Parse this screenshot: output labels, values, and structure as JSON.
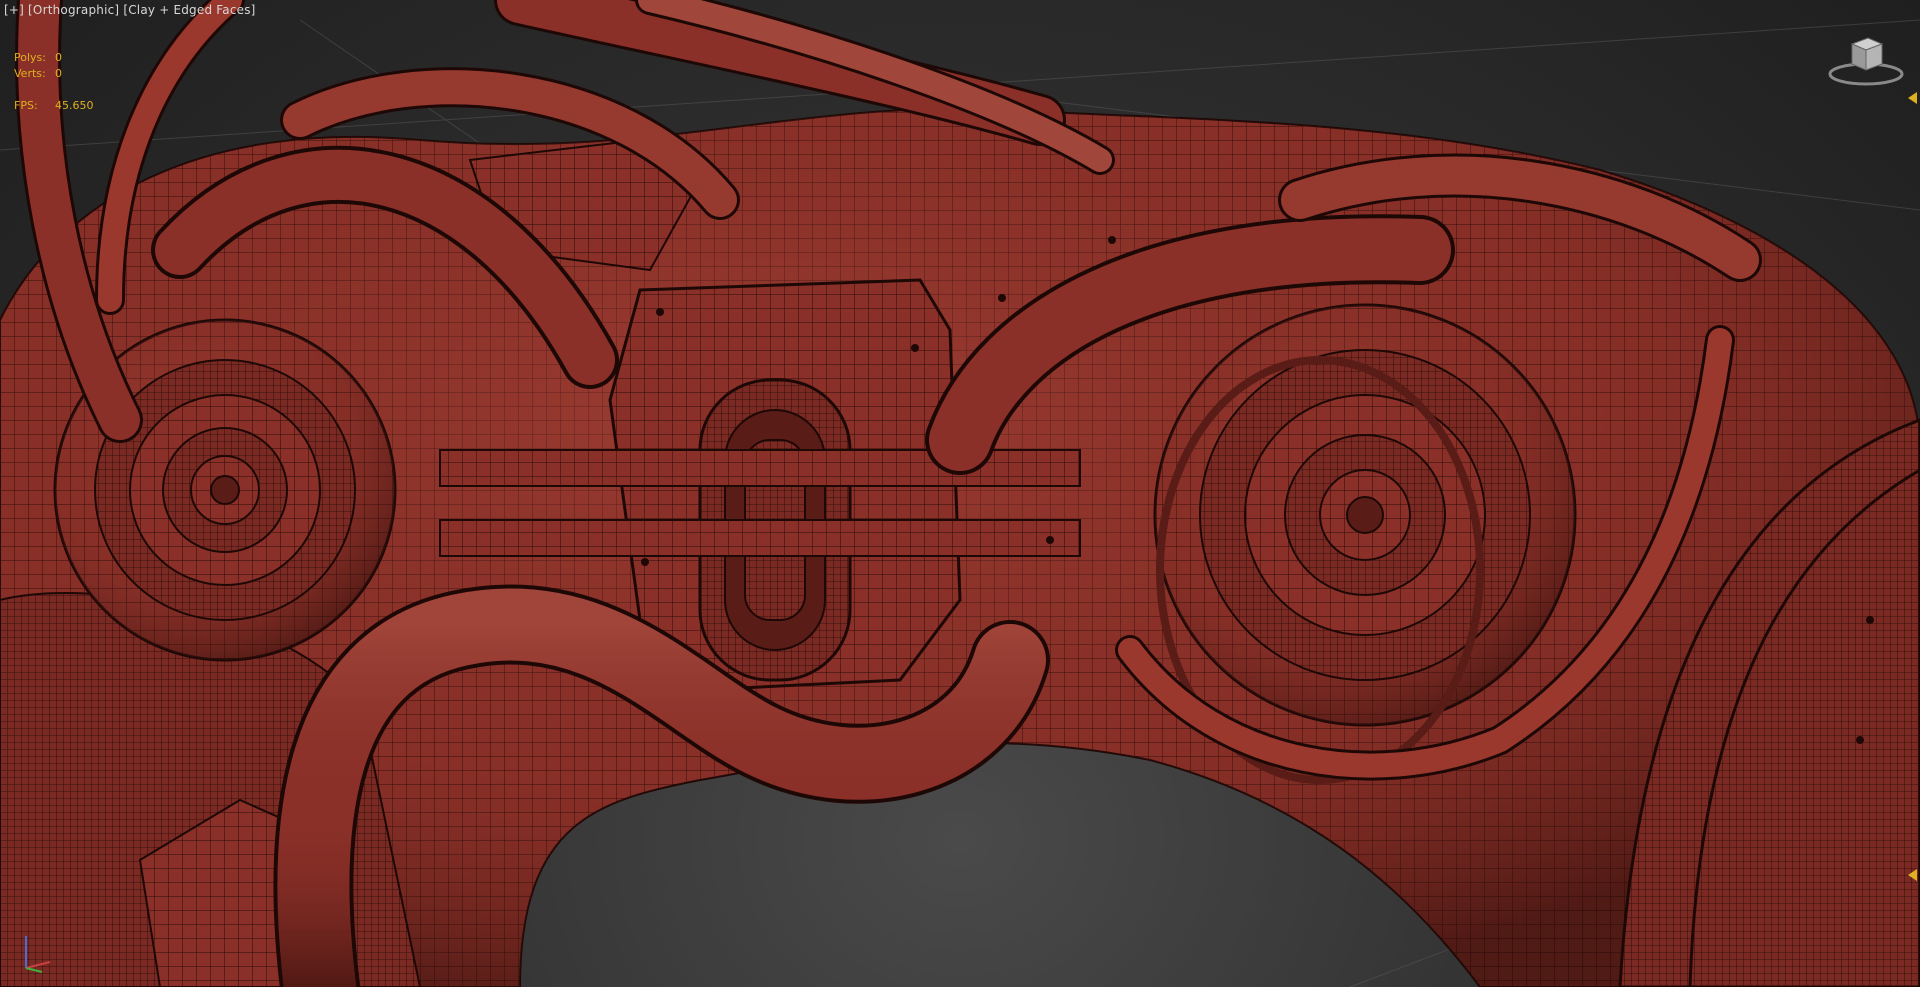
{
  "viewport": {
    "label_plus": "[+]",
    "label_view": "[Orthographic]",
    "label_shading": "[Clay + Edged Faces]"
  },
  "stats": {
    "polys_label": "Polys:",
    "polys_value": "0",
    "verts_label": "Verts:",
    "verts_value": "0",
    "fps_label": "FPS:",
    "fps_value": "45.650"
  },
  "colors": {
    "clay": "#8a3028",
    "clay_light": "#a8443a",
    "clay_dark": "#5a1c16",
    "wire": "#1e0806",
    "stats_text": "#e0b020",
    "label_text": "#d8d8d8"
  },
  "icons": [
    "viewcube-icon",
    "axis-tripod-icon"
  ]
}
